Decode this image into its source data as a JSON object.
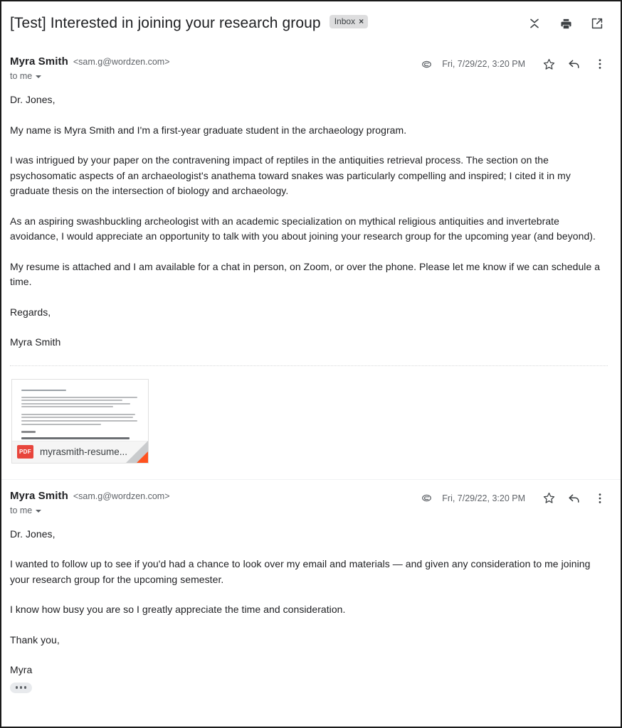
{
  "header": {
    "subject": "[Test] Interested in joining your research group",
    "label": "Inbox",
    "label_close": "×",
    "actions": {
      "collapse": "collapse-all",
      "print": "print-all",
      "popout": "open-in-new-window"
    }
  },
  "messages": [
    {
      "sender_name": "Myra Smith",
      "sender_email": "<sam.g@wordzen.com>",
      "recipient": "to me",
      "date": "Fri, 7/29/22, 3:20 PM",
      "has_attachment": true,
      "paragraphs": [
        "Dr. Jones,",
        "My name is Myra Smith and I'm a first-year graduate student in the archaeology program.",
        "I was intrigued by your paper on the contravening impact of reptiles in the antiquities retrieval process. The section on the psychosomatic aspects of an archaeologist's anathema toward snakes was particularly compelling and inspired; I cited it in my graduate thesis on the intersection of biology and archaeology.",
        "As an aspiring swashbuckling archeologist with an academic specialization on mythical religious antiquities and invertebrate avoidance, I would appreciate an opportunity to talk with you about joining your research group for the upcoming year (and beyond).",
        "My resume is attached and I am available for a chat in person, on Zoom, or over the phone. Please let me know if we can schedule a time.",
        "Regards,",
        "Myra Smith"
      ],
      "attachment": {
        "type_badge": "PDF",
        "filename": "myrasmith-resume...",
        "badge_color": "#e8453c",
        "corner_color": "#ff521f"
      }
    },
    {
      "sender_name": "Myra Smith",
      "sender_email": "<sam.g@wordzen.com>",
      "recipient": "to me",
      "date": "Fri, 7/29/22, 3:20 PM",
      "has_attachment": true,
      "paragraphs": [
        "Dr. Jones,",
        "I wanted to follow up to see if you'd had a chance to look over my email and materials — and given any consideration to me joining your research group for the upcoming semester.",
        "I know how busy you are so I greatly appreciate the time and consideration.",
        "Thank you,",
        "Myra"
      ],
      "trimmed_content": "…"
    }
  ]
}
